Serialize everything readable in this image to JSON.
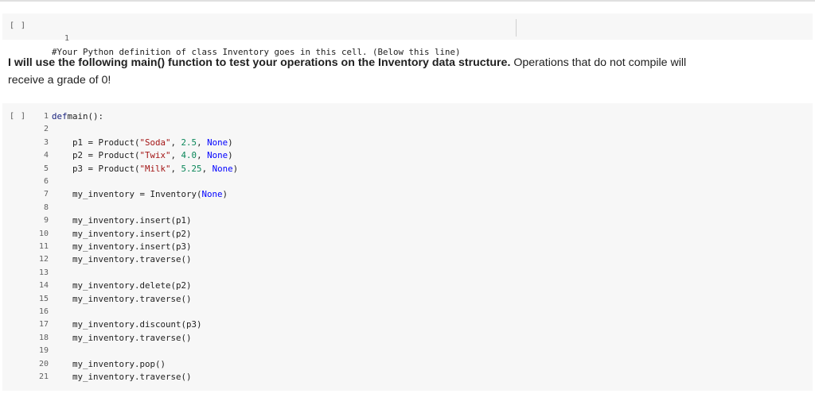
{
  "cell1": {
    "run_label": "[ ]",
    "line_number": "1",
    "code": "#Your Python definition of class Inventory goes in this cell. (Below this line)"
  },
  "markdown": {
    "bold_text": "I will use the following main() function to test your operations on the Inventory data structure.",
    "normal_text": " Operations that do not compile will receive a grade of 0!"
  },
  "cell2": {
    "run_label": "[ ]",
    "lines": [
      {
        "n": "1",
        "parts": [
          [
            "kw",
            "def"
          ],
          [
            "",
            "main():"
          ]
        ]
      },
      {
        "n": "2",
        "parts": []
      },
      {
        "n": "3",
        "parts": [
          [
            "",
            "    p1 = Product("
          ],
          [
            "str",
            "\"Soda\""
          ],
          [
            "",
            ", "
          ],
          [
            "num",
            "2.5"
          ],
          [
            "",
            ", "
          ],
          [
            "const",
            "None"
          ],
          [
            "",
            ")"
          ]
        ]
      },
      {
        "n": "4",
        "parts": [
          [
            "",
            "    p2 = Product("
          ],
          [
            "str",
            "\"Twix\""
          ],
          [
            "",
            ", "
          ],
          [
            "num",
            "4.0"
          ],
          [
            "",
            ", "
          ],
          [
            "const",
            "None"
          ],
          [
            "",
            ")"
          ]
        ]
      },
      {
        "n": "5",
        "parts": [
          [
            "",
            "    p3 = Product("
          ],
          [
            "str",
            "\"Milk\""
          ],
          [
            "",
            ", "
          ],
          [
            "num",
            "5.25"
          ],
          [
            "",
            ", "
          ],
          [
            "const",
            "None"
          ],
          [
            "",
            ")"
          ]
        ]
      },
      {
        "n": "6",
        "parts": []
      },
      {
        "n": "7",
        "parts": [
          [
            "",
            "    my_inventory = Inventory("
          ],
          [
            "const",
            "None"
          ],
          [
            "",
            ")"
          ]
        ]
      },
      {
        "n": "8",
        "parts": []
      },
      {
        "n": "9",
        "parts": [
          [
            "",
            "    my_inventory.insert(p1)"
          ]
        ]
      },
      {
        "n": "10",
        "parts": [
          [
            "",
            "    my_inventory.insert(p2)"
          ]
        ]
      },
      {
        "n": "11",
        "parts": [
          [
            "",
            "    my_inventory.insert(p3)"
          ]
        ]
      },
      {
        "n": "12",
        "parts": [
          [
            "",
            "    my_inventory.traverse()"
          ]
        ]
      },
      {
        "n": "13",
        "parts": []
      },
      {
        "n": "14",
        "parts": [
          [
            "",
            "    my_inventory.delete(p2)"
          ]
        ]
      },
      {
        "n": "15",
        "parts": [
          [
            "",
            "    my_inventory.traverse()"
          ]
        ]
      },
      {
        "n": "16",
        "parts": []
      },
      {
        "n": "17",
        "parts": [
          [
            "",
            "    my_inventory.discount(p3)"
          ]
        ]
      },
      {
        "n": "18",
        "parts": [
          [
            "",
            "    my_inventory.traverse()"
          ]
        ]
      },
      {
        "n": "19",
        "parts": []
      },
      {
        "n": "20",
        "parts": [
          [
            "",
            "    my_inventory.pop()"
          ]
        ]
      },
      {
        "n": "21",
        "parts": [
          [
            "",
            "    my_inventory.traverse()"
          ]
        ]
      }
    ]
  }
}
